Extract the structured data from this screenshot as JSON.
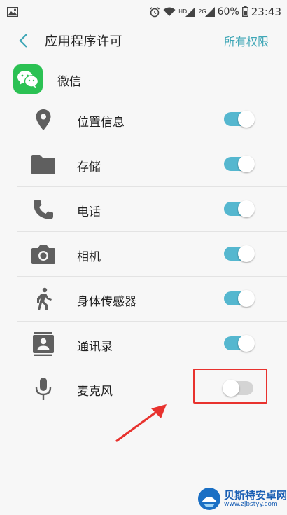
{
  "status_bar": {
    "battery_percent": "60%",
    "time": "23:43",
    "signal_label_1": "HD",
    "signal_label_2": "2G",
    "icons": [
      "image-icon",
      "alarm-icon",
      "wifi-icon",
      "signal-icon",
      "battery-icon"
    ]
  },
  "header": {
    "title": "应用程序许可",
    "all_permissions": "所有权限"
  },
  "app": {
    "name": "微信",
    "icon": "wechat-icon",
    "color": "#2bc153"
  },
  "permissions": [
    {
      "label": "位置信息",
      "icon": "location-icon",
      "enabled": true
    },
    {
      "label": "存储",
      "icon": "folder-icon",
      "enabled": true
    },
    {
      "label": "电话",
      "icon": "phone-icon",
      "enabled": true
    },
    {
      "label": "相机",
      "icon": "camera-icon",
      "enabled": true
    },
    {
      "label": "身体传感器",
      "icon": "running-person-icon",
      "enabled": true
    },
    {
      "label": "通讯录",
      "icon": "contacts-icon",
      "enabled": true
    },
    {
      "label": "麦克风",
      "icon": "microphone-icon",
      "enabled": false
    }
  ],
  "colors": {
    "accent": "#3ea6b6",
    "toggle_on": "#55b7cf",
    "toggle_off": "#d4d4d4",
    "highlight": "#e8322e"
  },
  "watermark": {
    "title": "贝斯特安卓网",
    "url": "www.zjbstyy.com"
  }
}
